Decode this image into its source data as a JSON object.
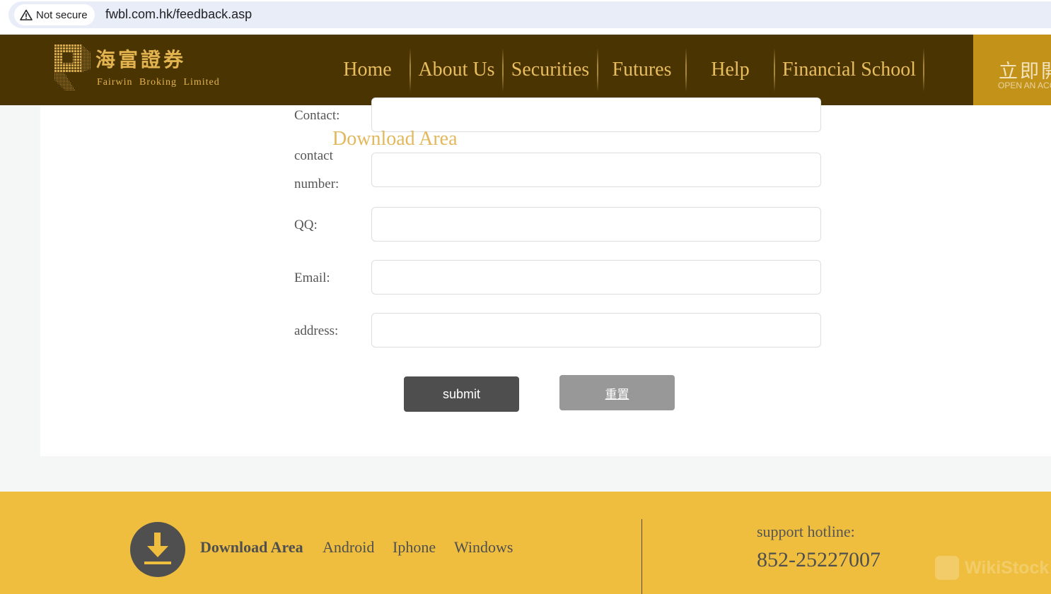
{
  "browser": {
    "security_label": "Not secure",
    "url": "fwbl.com.hk/feedback.asp"
  },
  "header": {
    "logo_cn": "海富證券",
    "logo_en": "Fairwin Broking Limited",
    "nav": [
      {
        "label": "Home"
      },
      {
        "label": "About Us"
      },
      {
        "label": "Securities"
      },
      {
        "label": "Futures"
      },
      {
        "label": "Help"
      },
      {
        "label": "Financial School"
      }
    ],
    "open_account": {
      "label_cn": "立即開戶",
      "label_en": "OPEN AN ACCOUNT"
    }
  },
  "form": {
    "floating_label": "Download Area",
    "fields": [
      {
        "label": "Contact:",
        "value": "",
        "placeholder": ""
      },
      {
        "label_line1": "contact",
        "label_line2": "number:",
        "value": "",
        "placeholder": ""
      },
      {
        "label": "QQ:",
        "value": "",
        "placeholder": ""
      },
      {
        "label": "Email:",
        "value": "",
        "placeholder": ""
      },
      {
        "label": "address:",
        "value": "",
        "placeholder": ""
      }
    ],
    "submit_label": "submit",
    "reset_label": "重置"
  },
  "footer": {
    "download_title": "Download Area",
    "links": [
      {
        "label": "Android"
      },
      {
        "label": "Iphone"
      },
      {
        "label": "Windows"
      }
    ],
    "hotline_label": "support hotline:",
    "hotline_number": "852-25227007",
    "watermark": "WikiStock"
  },
  "colors": {
    "header_bg": "#4a3402",
    "nav_text": "#e8bd5f",
    "open_account_bg": "#c39219",
    "footer_bg": "#efbe3e",
    "submit_bg": "#4e4e4e",
    "reset_bg": "#989898"
  }
}
